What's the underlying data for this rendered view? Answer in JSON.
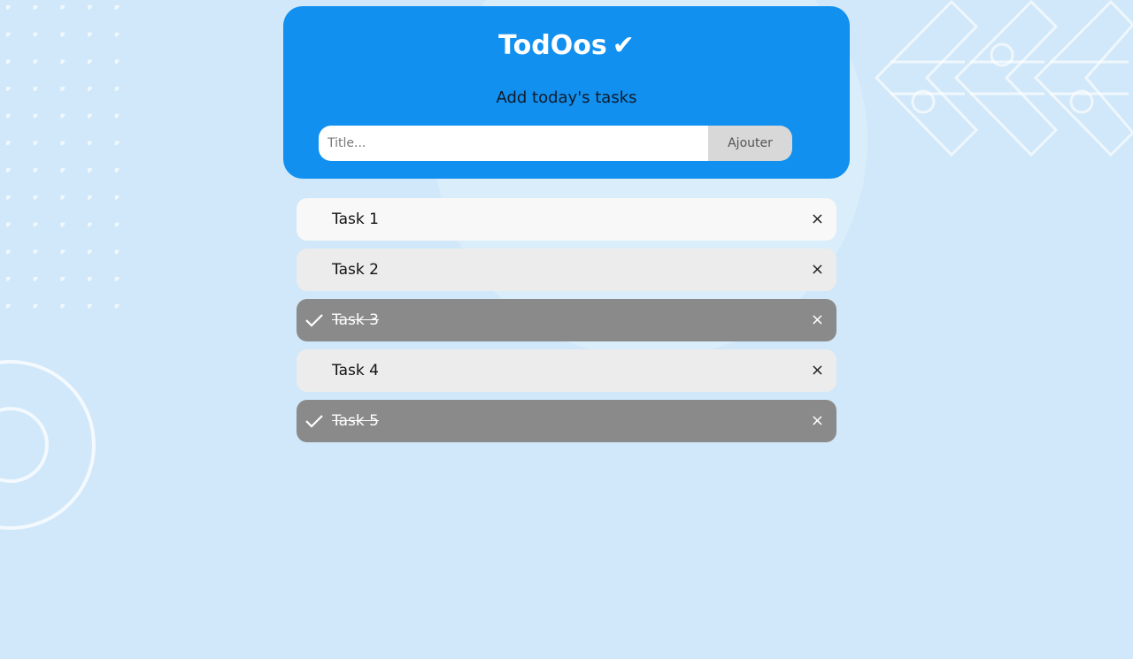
{
  "app": {
    "title": "TodOos",
    "title_check": "✔",
    "subtitle": "Add today's tasks"
  },
  "form": {
    "placeholder": "Title...",
    "value": "",
    "add_label": "Ajouter"
  },
  "tasks": [
    {
      "label": "Task 1",
      "done": false
    },
    {
      "label": "Task 2",
      "done": false
    },
    {
      "label": "Task 3",
      "done": true
    },
    {
      "label": "Task 4",
      "done": false
    },
    {
      "label": "Task 5",
      "done": true
    }
  ],
  "icons": {
    "delete": "×",
    "done": "check-icon"
  },
  "colors": {
    "background": "#d0e8f9",
    "header": "#1190ef",
    "task": "#ececec",
    "task_done": "#8a8a8a",
    "button": "#d8d8d8"
  }
}
